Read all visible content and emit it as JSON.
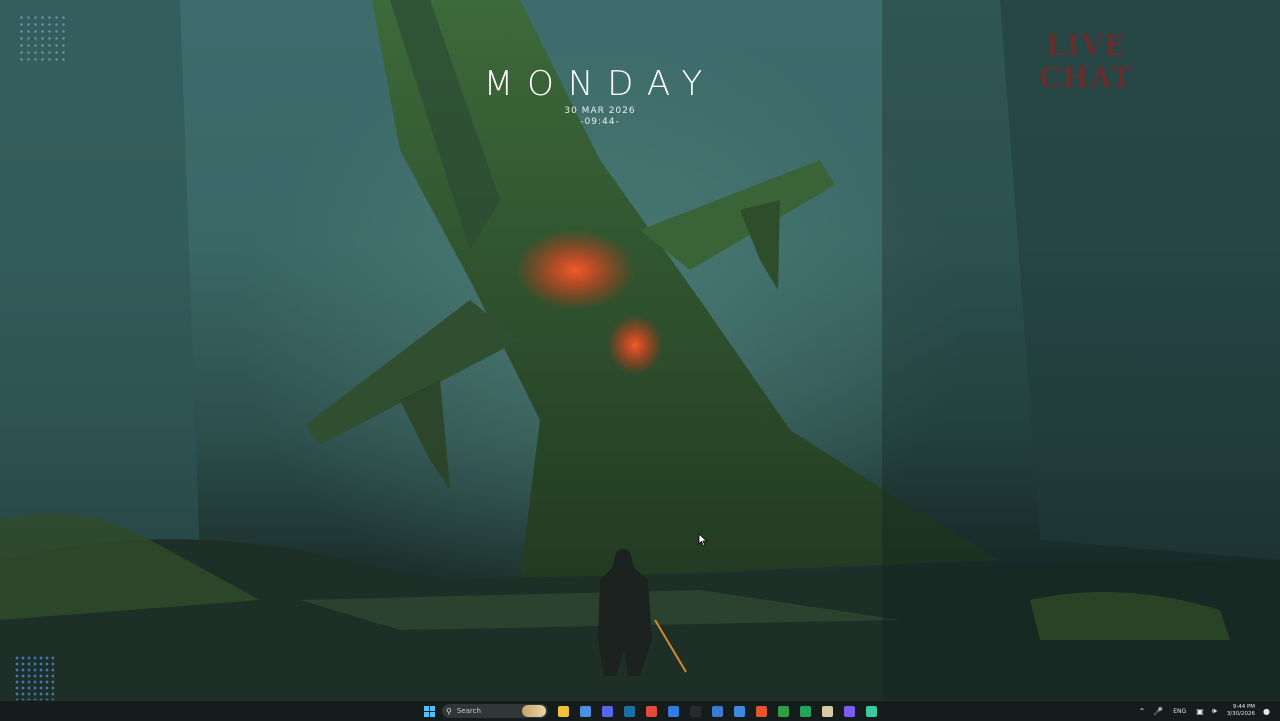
{
  "desktop": {
    "clock_widget": {
      "day": "MONDAY",
      "date": "30 MAR 2026",
      "time": "-09:44-"
    },
    "overlay_widget": {
      "top_text": "",
      "title": "LIVE CHAT"
    }
  },
  "taskbar": {
    "search_placeholder": "Search",
    "apps": [
      {
        "name": "file-explorer",
        "color": "#f3c13a"
      },
      {
        "name": "calendar",
        "color": "#4a8fe0"
      },
      {
        "name": "discord",
        "color": "#5865f2"
      },
      {
        "name": "steam",
        "color": "#1b6fa8"
      },
      {
        "name": "chrome",
        "color": "#e6483a"
      },
      {
        "name": "app-blue",
        "color": "#2f7de1"
      },
      {
        "name": "epic-games",
        "color": "#2a2a2a"
      },
      {
        "name": "vpn",
        "color": "#3a7bd5"
      },
      {
        "name": "mail",
        "color": "#3d8be0"
      },
      {
        "name": "brave",
        "color": "#e8552d"
      },
      {
        "name": "xbox",
        "color": "#2f9e44"
      },
      {
        "name": "xbox-app",
        "color": "#23a559"
      },
      {
        "name": "notepad",
        "color": "#d9c9a4"
      },
      {
        "name": "copilot",
        "color": "#7b5cf0"
      },
      {
        "name": "terminal-app",
        "color": "#3cc8a0"
      }
    ],
    "tray": {
      "lang": "ENG",
      "time": "9:44 PM",
      "date": "3/30/2026"
    }
  }
}
